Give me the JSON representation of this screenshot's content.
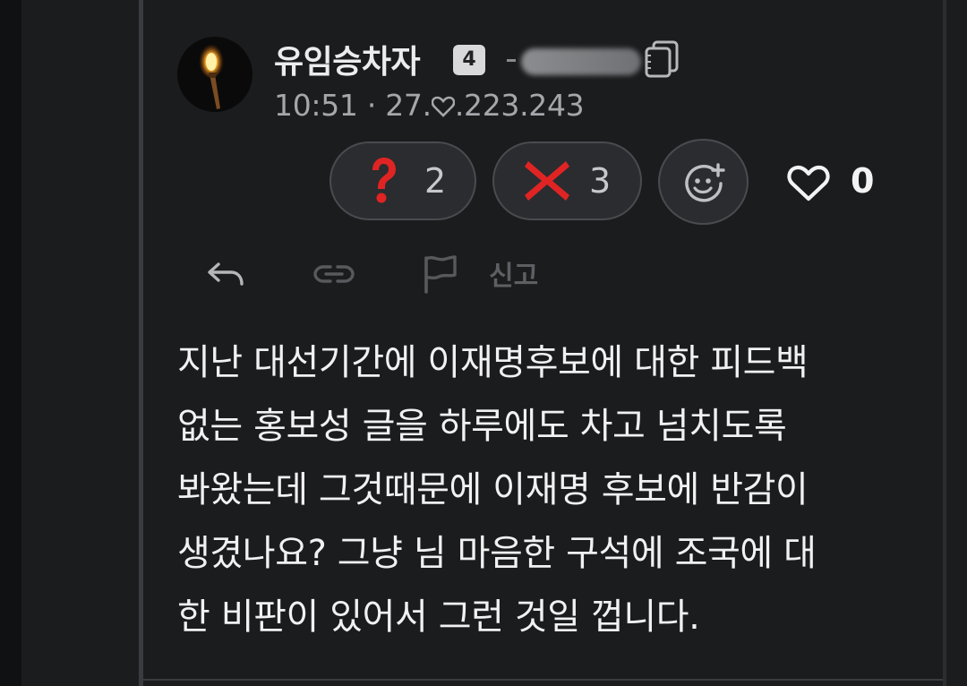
{
  "author": {
    "username": "유임승차자",
    "level": "4",
    "avatar_icon": "torch-icon"
  },
  "meta": {
    "time": "10:51",
    "separator": "·",
    "ip_prefix": "27.",
    "ip_suffix": ".223.243",
    "ip_mask_icon": "heart-outline-icon"
  },
  "reactions": [
    {
      "emoji": "question-mark-icon",
      "count": "2"
    },
    {
      "emoji": "cross-mark-icon",
      "count": "3"
    }
  ],
  "add_reaction_icon": "smiley-plus-icon",
  "likes": {
    "icon": "heart-icon",
    "count": "0"
  },
  "actions": {
    "reply_icon": "reply-arrow-icon",
    "link_icon": "link-icon",
    "report_icon": "flag-icon",
    "report_label": "신고"
  },
  "comment": {
    "lines": [
      "지난 대선기간에 이재명후보에 대한 피드백",
      "없는 홍보성 글을 하루에도 차고 넘치도록",
      "봐왔는데 그것때문에 이재명 후보에 반감이",
      "생겼나요? 그냥 님 마음한 구석에 조국에 대",
      "한 비판이 있어서 그런 것일 껍니다."
    ]
  },
  "colors": {
    "background": "#1b1c1e",
    "text": "#f1f1f2",
    "muted": "#a6a7aa",
    "reaction_bg": "#2b2c2f",
    "reaction_border": "#4a4b4f",
    "accent_red": "#e02424"
  }
}
